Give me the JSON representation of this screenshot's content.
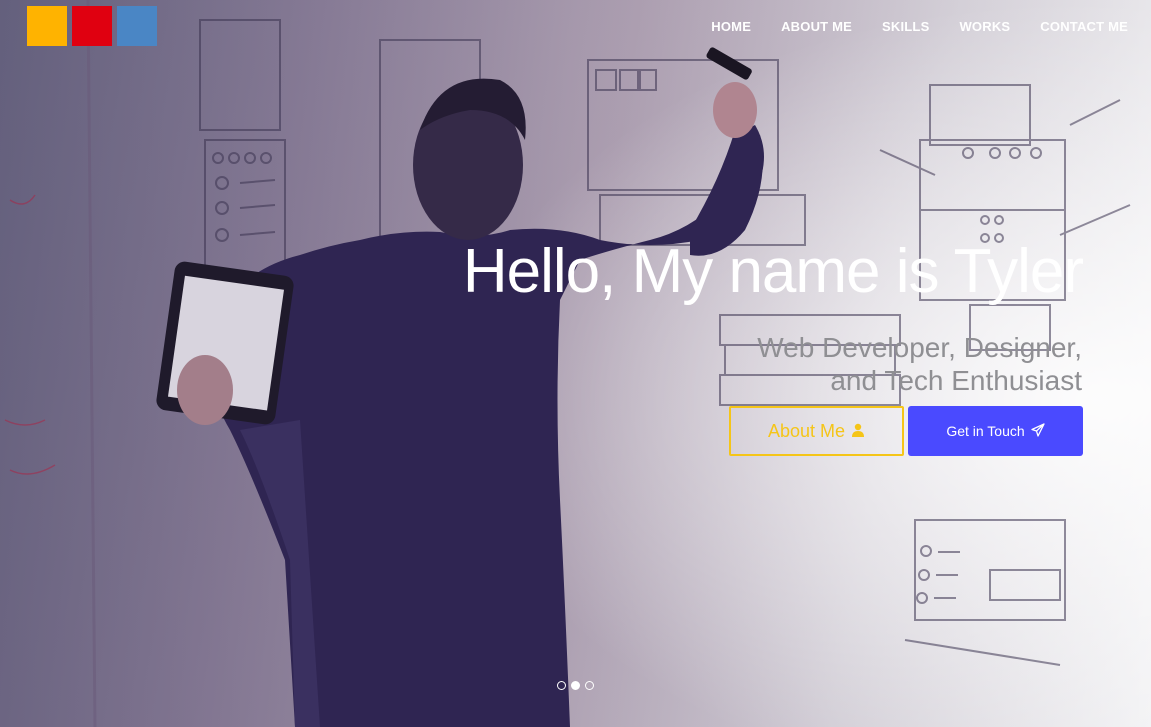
{
  "logo": {
    "squares": [
      {
        "color": "#FFB300"
      },
      {
        "color": "#E00010"
      },
      {
        "color": "#4A86C5"
      }
    ]
  },
  "nav": {
    "items": [
      "HOME",
      "ABOUT ME",
      "SKILLS",
      "WORKS",
      "CONTACT ME"
    ]
  },
  "hero": {
    "title": "Hello, My name is Tyler",
    "subtitle_line1": "Web Developer, Designer,",
    "subtitle_line2": "and Tech Enthusiast",
    "about_button": "About Me",
    "about_icon": "user-icon",
    "touch_button": "Get in Touch",
    "touch_icon": "paper-plane-icon"
  },
  "carousel": {
    "slides": 3,
    "active_index": 1
  },
  "colors": {
    "accent_yellow": "#F5C518",
    "accent_blue": "#4A4AFF"
  }
}
